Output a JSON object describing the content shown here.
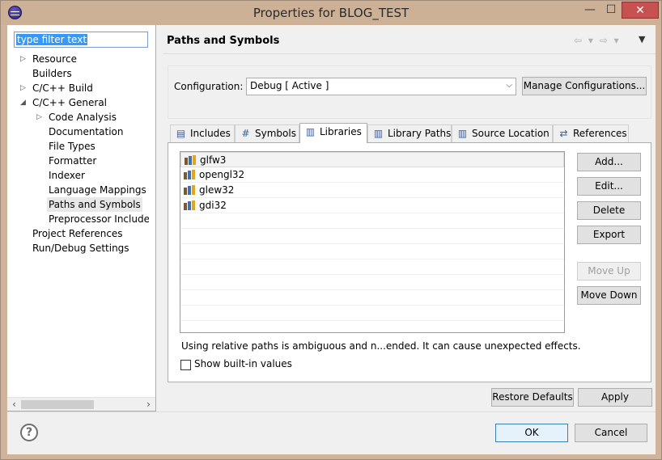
{
  "window": {
    "title": "Properties for BLOG_TEST",
    "minimize": "—",
    "maximize": "☐",
    "close": "✕"
  },
  "filter": {
    "value": "type filter text"
  },
  "tree": {
    "items": [
      {
        "label": "Resource",
        "twisty": "▷"
      },
      {
        "label": "Builders"
      },
      {
        "label": "C/C++ Build",
        "twisty": "▷"
      },
      {
        "label": "C/C++ General",
        "twisty": "◢"
      },
      {
        "label": "Code Analysis",
        "twisty": "▷"
      },
      {
        "label": "Documentation"
      },
      {
        "label": "File Types"
      },
      {
        "label": "Formatter"
      },
      {
        "label": "Indexer"
      },
      {
        "label": "Language Mappings"
      },
      {
        "label": "Paths and Symbols",
        "selected": true
      },
      {
        "label": "Preprocessor Include P"
      },
      {
        "label": "Project References"
      },
      {
        "label": "Run/Debug Settings"
      }
    ],
    "scroll_left": "‹",
    "scroll_right": "›"
  },
  "page": {
    "title": "Paths and Symbols",
    "nav_arrows": "⇦ ▾ ⇨ ▾",
    "nav_menu": "▼"
  },
  "configuration": {
    "label": "Configuration:",
    "selected": "Debug  [ Active ]",
    "manage_button": "Manage Configurations..."
  },
  "tabs": [
    {
      "label": "Includes",
      "icon": "▤"
    },
    {
      "label": "Symbols",
      "icon": "#"
    },
    {
      "label": "Libraries",
      "icon": "▥",
      "active": true
    },
    {
      "label": "Library Paths",
      "icon": "▥"
    },
    {
      "label": "Source Location",
      "icon": "▥"
    },
    {
      "label": "References",
      "icon": "⇄"
    }
  ],
  "libraries": [
    "glfw3",
    "opengl32",
    "glew32",
    "gdi32"
  ],
  "side_buttons": {
    "add": "Add...",
    "edit": "Edit...",
    "delete": "Delete",
    "export": "Export",
    "move_up": "Move Up",
    "move_down": "Move Down"
  },
  "warning": "Using relative paths is ambiguous and n...ended. It can cause unexpected effects.",
  "show_builtin": "Show built-in values",
  "restore_defaults": "Restore Defaults",
  "apply": "Apply",
  "help": "?",
  "ok": "OK",
  "cancel": "Cancel",
  "colors": {
    "title_bar": "#cdb197",
    "close_button": "#c75050",
    "selection": "#3399ff"
  }
}
